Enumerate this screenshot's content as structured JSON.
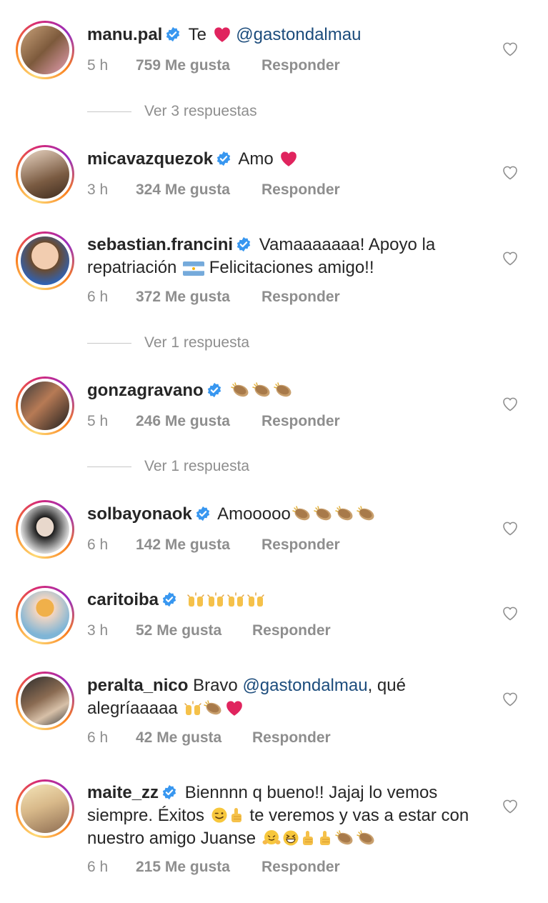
{
  "comments": [
    {
      "username": "manu.pal",
      "verified": true,
      "text_parts": [
        "Te",
        "@gastondalmau"
      ],
      "time": "5 h",
      "likes": "759 Me gusta",
      "reply": "Responder",
      "view_replies": "Ver 3 respuestas"
    },
    {
      "username": "micavazquezok",
      "verified": true,
      "text_parts": [
        "Amo"
      ],
      "time": "3 h",
      "likes": "324 Me gusta",
      "reply": "Responder"
    },
    {
      "username": "sebastian.francini",
      "verified": true,
      "text_parts": [
        "Vamaaaaaaa! Apoyo la repatriación",
        "Felicitaciones amigo!!"
      ],
      "time": "6 h",
      "likes": "372 Me gusta",
      "reply": "Responder",
      "view_replies": "Ver 1 respuesta"
    },
    {
      "username": "gonzagravano",
      "verified": true,
      "text_parts": [],
      "time": "5 h",
      "likes": "246 Me gusta",
      "reply": "Responder",
      "view_replies": "Ver 1 respuesta"
    },
    {
      "username": "solbayonaok",
      "verified": true,
      "text_parts": [
        "Amooooo"
      ],
      "time": "6 h",
      "likes": "142 Me gusta",
      "reply": "Responder"
    },
    {
      "username": "caritoiba",
      "verified": true,
      "text_parts": [],
      "time": "3 h",
      "likes": "52 Me gusta",
      "reply": "Responder"
    },
    {
      "username": "peralta_nico",
      "verified": false,
      "text_parts": [
        "Bravo",
        "@gastondalmau",
        ", qué alegríaaaaa"
      ],
      "time": "6 h",
      "likes": "42 Me gusta",
      "reply": "Responder"
    },
    {
      "username": "maite_zz",
      "verified": true,
      "text_parts": [
        "Biennnn q bueno!! Jajaj lo vemos siempre. Éxitos",
        "te veremos y vas a estar con nuestro amigo Juanse"
      ],
      "time": "6 h",
      "likes": "215 Me gusta",
      "reply": "Responder"
    }
  ],
  "icons": {
    "verified": "verified-badge-icon",
    "like": "heart-outline-icon",
    "emoji_heart": "red-heart-emoji",
    "emoji_clap": "clapping-hands-emoji",
    "emoji_raised": "raising-hands-emoji",
    "emoji_wink": "winking-face-emoji",
    "emoji_thumb": "thumbs-up-emoji",
    "emoji_hug": "hugging-face-emoji",
    "emoji_laugh": "grinning-squinting-emoji",
    "flag": "argentina-flag-emoji"
  },
  "colors": {
    "verified": "#3897f0",
    "mention": "#1c4c7c",
    "meta": "#8e8e8e",
    "heart": "#e0245e"
  }
}
